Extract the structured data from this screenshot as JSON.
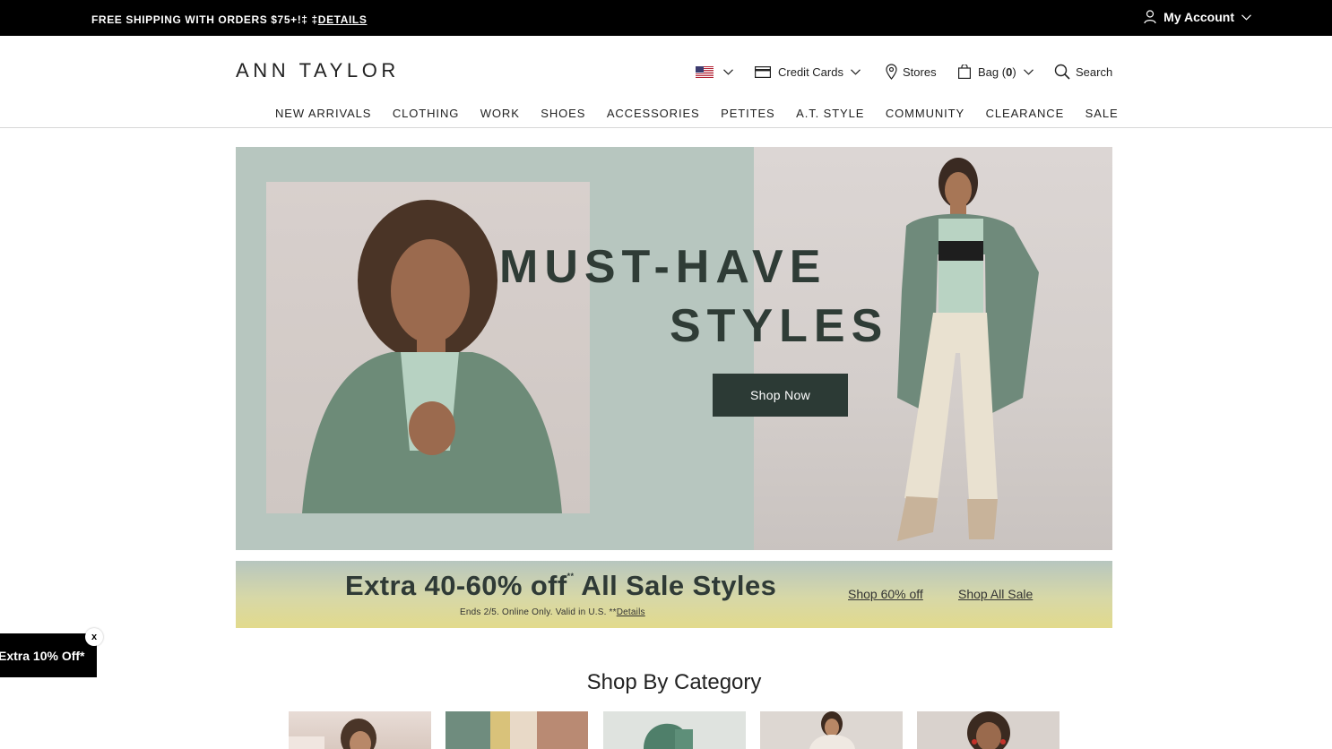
{
  "promo_bar": {
    "shipping_text": "FREE SHIPPING WITH ORDERS $75+!‡ ‡",
    "details_link": "DETAILS",
    "account_label": "My Account"
  },
  "header": {
    "logo": "ANN TAYLOR",
    "credit_cards": "Credit Cards",
    "stores": "Stores",
    "bag_label": "Bag (",
    "bag_count": "0",
    "bag_close": ")",
    "search": "Search"
  },
  "nav": {
    "items": [
      "NEW ARRIVALS",
      "CLOTHING",
      "WORK",
      "SHOES",
      "ACCESSORIES",
      "PETITES",
      "A.T. STYLE",
      "COMMUNITY",
      "CLEARANCE",
      "SALE"
    ]
  },
  "hero": {
    "title_line1": "MUST-HAVE",
    "title_line2": "STYLES",
    "cta": "Shop Now"
  },
  "sale_banner": {
    "title": "Extra 40-60% off",
    "title_mark": "**",
    "title_rest": " All Sale Styles",
    "subtext": "Ends 2/5. Online Only. Valid in U.S. **",
    "details_link": "Details",
    "link1": "Shop 60% off",
    "link2": "Shop All Sale"
  },
  "floating_tab": {
    "label": "Extra 10% Off*",
    "close": "x"
  },
  "categories": {
    "heading": "Shop By Category"
  },
  "colors": {
    "hero_sage": "#b7c6bf",
    "button_dark": "#2c3a35",
    "title_green": "#2f3c36",
    "banner_yellow": "#e2da8c"
  }
}
